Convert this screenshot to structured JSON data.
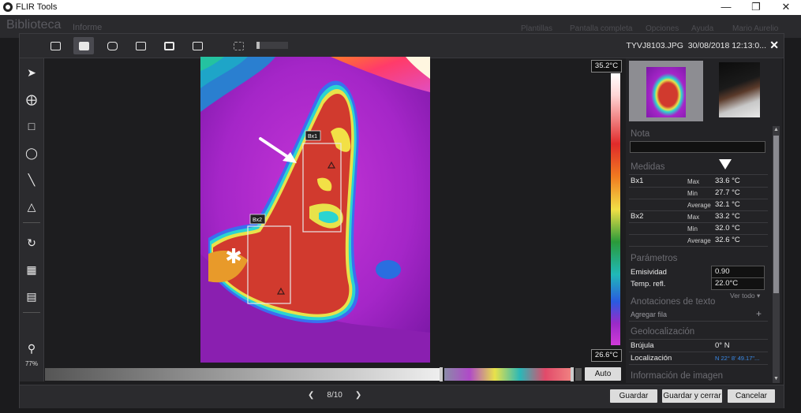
{
  "titlebar": {
    "title": "FLIR Tools"
  },
  "app": {
    "library": "Biblioteca",
    "tab_informe": "Informe",
    "menu": [
      "Plantillas",
      "Pantalla completa",
      "Opciones",
      "Ayuda",
      "Mario Aurelio"
    ]
  },
  "dialog": {
    "filename": "TYVJ8103.JPG",
    "datetime": "30/08/2018 12:13:0...",
    "zoom": "77%",
    "scale_max": "35.2°C",
    "scale_min": "26.6°C",
    "auto_label": "Auto",
    "box_labels": {
      "bx1": "Bx1",
      "bx2": "Bx2"
    },
    "pager": {
      "current": "8/10"
    },
    "buttons": {
      "save": "Guardar",
      "save_close": "Guardar y cerrar",
      "cancel": "Cancelar"
    }
  },
  "panel": {
    "nota_title": "Nota",
    "medidas_title": "Medidas",
    "measurements": [
      {
        "name": "Bx1",
        "rows": [
          {
            "stat": "Max",
            "value": "33.6 °C"
          },
          {
            "stat": "Min",
            "value": "27.7 °C"
          },
          {
            "stat": "Average",
            "value": "32.1 °C"
          }
        ]
      },
      {
        "name": "Bx2",
        "rows": [
          {
            "stat": "Max",
            "value": "33.2 °C"
          },
          {
            "stat": "Min",
            "value": "32.0 °C"
          },
          {
            "stat": "Average",
            "value": "32.6 °C"
          }
        ]
      }
    ],
    "parametros_title": "Parámetros",
    "params": [
      {
        "label": "Emisividad",
        "value": "0.90"
      },
      {
        "label": "Temp. refl.",
        "value": "22.0°C"
      }
    ],
    "ver_todo": "Ver todo",
    "anotaciones_title": "Anotaciones de texto",
    "agregar_fila": "Agregar fila",
    "geo_title": "Geolocalización",
    "geo": [
      {
        "label": "Brújula",
        "value": "0° N"
      },
      {
        "label": "Localización",
        "value": "N 22° 8' 49.17\"..."
      }
    ],
    "info_title": "Información de imagen"
  }
}
